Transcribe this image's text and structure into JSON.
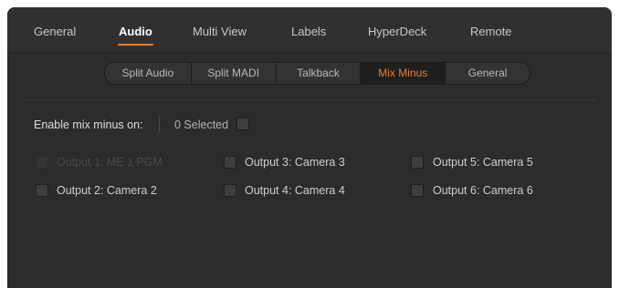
{
  "main_tabs": [
    {
      "label": "General",
      "active": false
    },
    {
      "label": "Audio",
      "active": true
    },
    {
      "label": "Multi View",
      "active": false
    },
    {
      "label": "Labels",
      "active": false
    },
    {
      "label": "HyperDeck",
      "active": false
    },
    {
      "label": "Remote",
      "active": false
    }
  ],
  "sub_tabs": [
    {
      "label": "Split Audio",
      "active": false
    },
    {
      "label": "Split MADI",
      "active": false
    },
    {
      "label": "Talkback",
      "active": false
    },
    {
      "label": "Mix Minus",
      "active": true
    },
    {
      "label": "General",
      "active": false
    }
  ],
  "mix_minus": {
    "enable_label": "Enable mix minus on:",
    "selected_text": "0 Selected",
    "select_all_checked": false
  },
  "outputs": [
    {
      "label": "Output 1: ME 1 PGM",
      "checked": false,
      "disabled": true
    },
    {
      "label": "Output 2: Camera 2",
      "checked": false,
      "disabled": false
    },
    {
      "label": "Output 3: Camera 3",
      "checked": false,
      "disabled": false
    },
    {
      "label": "Output 4: Camera 4",
      "checked": false,
      "disabled": false
    },
    {
      "label": "Output 5: Camera 5",
      "checked": false,
      "disabled": false
    },
    {
      "label": "Output 6: Camera 6",
      "checked": false,
      "disabled": false
    }
  ],
  "colors": {
    "accent": "#f07d28",
    "panel_bg": "#2c2c2c",
    "text": "#cfcfcf",
    "disabled_text": "#4b4b4b"
  }
}
